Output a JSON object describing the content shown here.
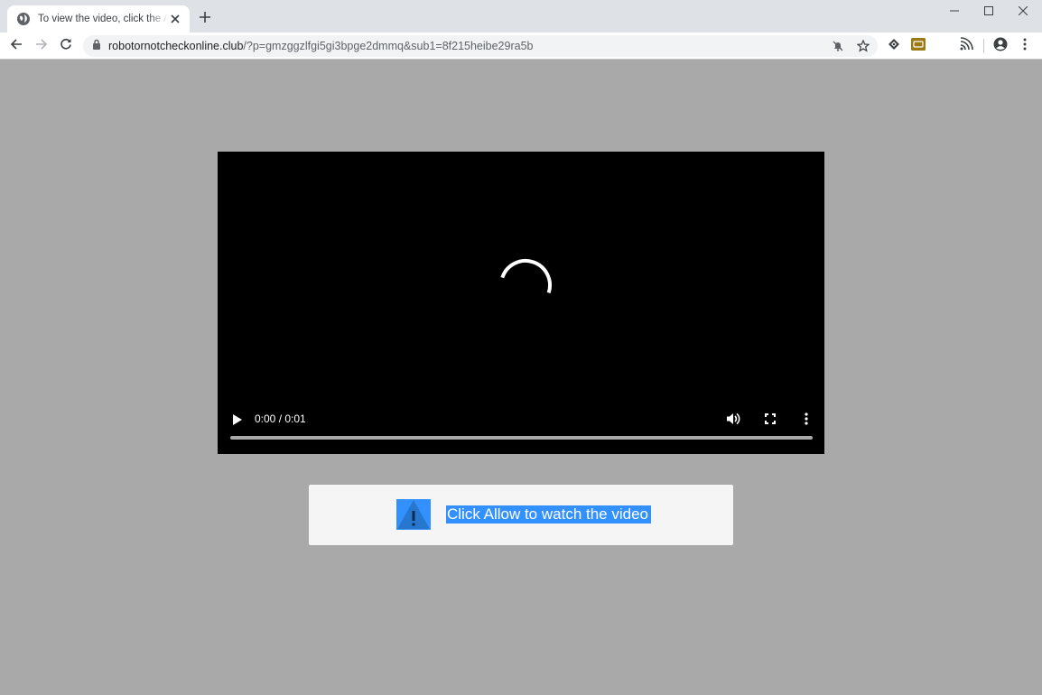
{
  "browser": {
    "tab": {
      "title": "To view the video, click the Allow"
    },
    "url": {
      "host": "robotornotcheckonline.club",
      "rest": "/?p=gmzggzlfgi5gi3bpge2dmmq&sub1=8f215heibe29ra5b"
    }
  },
  "icons": [
    "globe-icon",
    "close-icon",
    "plus-icon",
    "minimize-icon",
    "maximize-icon",
    "back-icon",
    "forward-icon",
    "reload-icon",
    "lock-icon",
    "notifications-blocked-icon",
    "star-icon",
    "extension-icon",
    "cc-extension-icon",
    "cast-icon",
    "account-icon",
    "menu-icon"
  ],
  "video": {
    "time": "0:00 / 0:01",
    "progress": 0.0
  },
  "prompt": {
    "text": "Click Allow to watch the video"
  },
  "colors": {
    "page_background": "#a9a9a9",
    "selection_highlight": "#3390ff",
    "warning_icon_blue": "#2f86dc"
  }
}
